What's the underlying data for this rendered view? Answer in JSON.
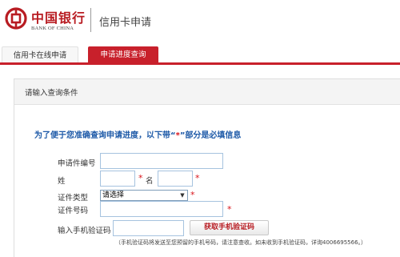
{
  "header": {
    "logo_cn": "中国银行",
    "logo_en": "BANK OF CHINA",
    "title": "信用卡申请"
  },
  "tabs": [
    {
      "label": "信用卡在线申请",
      "active": false
    },
    {
      "label": "申请进度查询",
      "active": true
    }
  ],
  "panel": {
    "title": "请输入查询条件"
  },
  "notice": {
    "before": "为了便于您准确查询申请进度，以下带",
    "quote_open": "“",
    "star": "*",
    "quote_close": "”",
    "after": "部分是必填信息"
  },
  "form": {
    "app_no_label": "申请件编号",
    "surname_label": "姓",
    "given_name_label": "名",
    "id_type_label": "证件类型",
    "id_type_selected": "请选择",
    "id_no_label": "证件号码",
    "sms_label": "输入手机验证码",
    "get_code_button": "获取手机验证码",
    "required_mark": "*",
    "tip": "（手机验证码将发送至您预留的手机号码，请注意查收。如未收到手机验证码，详询4006695566。）"
  },
  "colors": {
    "brand_red": "#c8202b",
    "notice_blue": "#1e5aa8",
    "required_red": "#d9141b"
  }
}
